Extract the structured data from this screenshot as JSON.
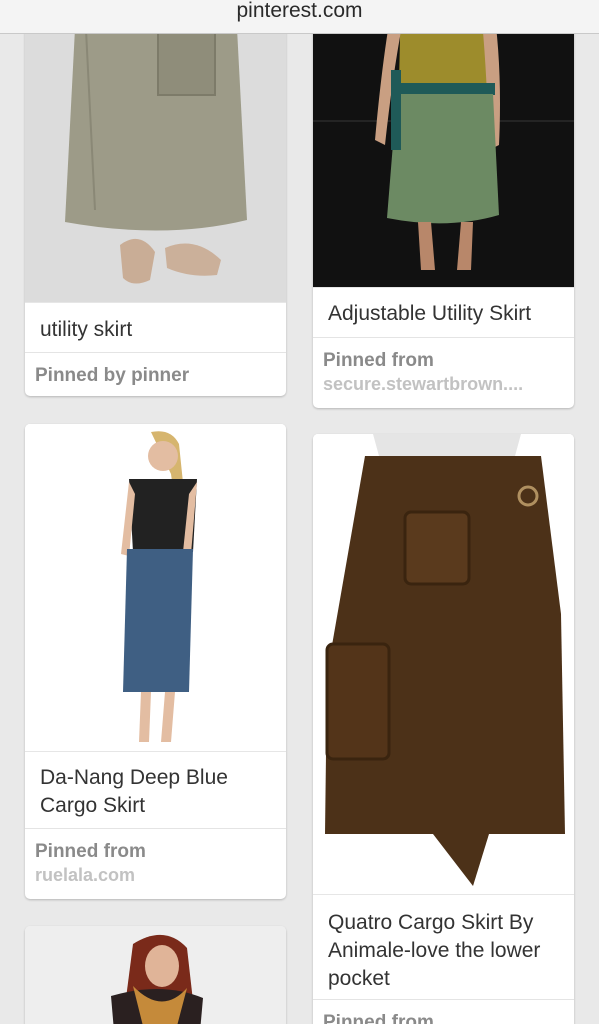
{
  "browser": {
    "url": "pinterest.com"
  },
  "pins": [
    {
      "title": "utility skirt",
      "pinned_label": "Pinned by pinner",
      "source": ""
    },
    {
      "title": "Adjustable Utility Skirt",
      "pinned_label": "Pinned from",
      "source": "secure.stewartbrown...."
    },
    {
      "title": "Da-Nang Deep Blue Cargo Skirt",
      "title_line1": "Da-Nang Deep Blue",
      "title_line2": "Cargo Skirt",
      "pinned_label": "Pinned from",
      "source": "ruelala.com"
    },
    {
      "title": "Quatro Cargo Skirt By Animale-love the lower pocket",
      "title_line1": "Quatro Cargo Skirt By",
      "title_line2": "Animale-love the lower",
      "title_line3": "pocket",
      "pinned_label": "Pinned from",
      "source": ""
    },
    {
      "title": "",
      "pinned_label": "",
      "source": ""
    }
  ],
  "colors": {
    "background": "#e9e9e9",
    "card": "#ffffff",
    "meta_text": "#8a8a8a",
    "source_text": "#c2c2c2"
  }
}
